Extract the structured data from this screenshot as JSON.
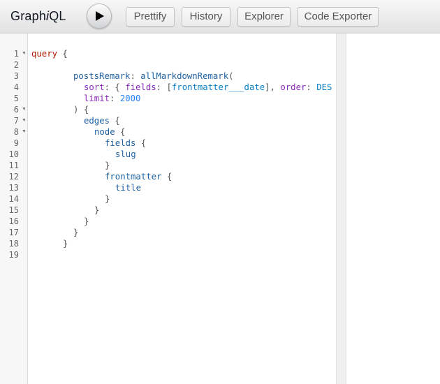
{
  "app": {
    "title_plain": "Graph",
    "title_italic": "i",
    "title_end": "QL"
  },
  "toolbar": {
    "execute_label": "Execute query",
    "prettify": "Prettify",
    "history": "History",
    "explorer": "Explorer",
    "code_exporter": "Code Exporter"
  },
  "editor": {
    "line_numbers": [
      "1",
      "2",
      "3",
      "4",
      "5",
      "6",
      "7",
      "8",
      "9",
      "10",
      "11",
      "12",
      "13",
      "14",
      "15",
      "16",
      "17",
      "18",
      "19"
    ],
    "query_keyword": "query",
    "alias": "postsRemark",
    "field_all_markdown": "allMarkdownRemark",
    "arg_sort": "sort",
    "arg_fields": "fields",
    "enum_date": "frontmatter___date",
    "arg_order": "order",
    "enum_order_partial": "DES",
    "arg_limit": "limit",
    "limit_value": "2000",
    "field_edges": "edges",
    "field_node": "node",
    "field_fields": "fields",
    "field_slug": "slug",
    "field_frontmatter": "frontmatter",
    "field_title": "title"
  }
}
